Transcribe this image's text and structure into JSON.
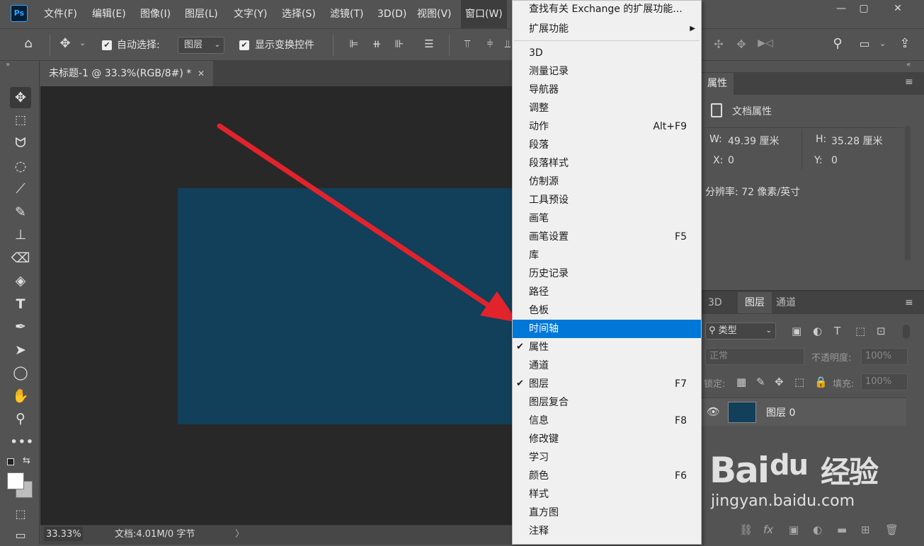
{
  "app": {
    "logo": "Ps"
  },
  "menubar": {
    "items": [
      "文件(F)",
      "编辑(E)",
      "图像(I)",
      "图层(L)",
      "文字(Y)",
      "选择(S)",
      "滤镜(T)",
      "3D(D)",
      "视图(V)",
      "窗口(W)"
    ],
    "window_controls": {
      "minimize": "—",
      "restore": "▢",
      "close": "✕"
    }
  },
  "options_bar": {
    "auto_select_label": "自动选择:",
    "auto_select_value": "图层",
    "show_transform_label": "显示变换控件"
  },
  "document": {
    "tab_title": "未标题-1 @ 33.3%(RGB/8#) *",
    "tab_close": "✕",
    "canvas_color": "#123f5a"
  },
  "statusbar": {
    "zoom": "33.33%",
    "doc_info": "文档:4.01M/0 字节",
    "arrow": "〉"
  },
  "properties_panel": {
    "tab": "属性",
    "doc_props_label": "文档属性",
    "w_label": "W:",
    "w_value": "49.39 厘米",
    "h_label": "H:",
    "h_value": "35.28 厘米",
    "x_label": "X:",
    "x_value": "0",
    "y_label": "Y:",
    "y_value": "0",
    "resolution": "分辨率: 72 像素/英寸"
  },
  "layers_panel": {
    "tabs": [
      "3D",
      "图层",
      "通道"
    ],
    "filter_label": "类型",
    "blend_mode": "正常",
    "opacity_label": "不透明度:",
    "opacity_value": "100%",
    "lock_label": "锁定:",
    "fill_label": "填充:",
    "fill_value": "100%",
    "layer_name": "图层 0",
    "layer_color": "#123f5a"
  },
  "window_menu": {
    "top": [
      {
        "label": "查找有关 Exchange 的扩展功能..."
      },
      {
        "label": "扩展功能",
        "submenu": true
      }
    ],
    "items": [
      {
        "label": "3D",
        "shortcut": ""
      },
      {
        "label": "测量记录",
        "shortcut": ""
      },
      {
        "label": "导航器",
        "shortcut": ""
      },
      {
        "label": "调整",
        "shortcut": ""
      },
      {
        "label": "动作",
        "shortcut": "Alt+F9"
      },
      {
        "label": "段落",
        "shortcut": ""
      },
      {
        "label": "段落样式",
        "shortcut": ""
      },
      {
        "label": "仿制源",
        "shortcut": ""
      },
      {
        "label": "工具预设",
        "shortcut": ""
      },
      {
        "label": "画笔",
        "shortcut": ""
      },
      {
        "label": "画笔设置",
        "shortcut": "F5"
      },
      {
        "label": "库",
        "shortcut": ""
      },
      {
        "label": "历史记录",
        "shortcut": ""
      },
      {
        "label": "路径",
        "shortcut": ""
      },
      {
        "label": "色板",
        "shortcut": ""
      },
      {
        "label": "时间轴",
        "shortcut": "",
        "highlighted": true
      },
      {
        "label": "属性",
        "shortcut": "",
        "checked": true
      },
      {
        "label": "通道",
        "shortcut": ""
      },
      {
        "label": "图层",
        "shortcut": "F7",
        "checked": true
      },
      {
        "label": "图层复合",
        "shortcut": ""
      },
      {
        "label": "信息",
        "shortcut": "F8"
      },
      {
        "label": "修改键",
        "shortcut": ""
      },
      {
        "label": "学习",
        "shortcut": ""
      },
      {
        "label": "颜色",
        "shortcut": "F6"
      },
      {
        "label": "样式",
        "shortcut": ""
      },
      {
        "label": "直方图",
        "shortcut": ""
      },
      {
        "label": "注释",
        "shortcut": ""
      }
    ]
  },
  "watermark": {
    "brand": "Bai",
    "brand2": "du",
    "jingyan": "经验",
    "url": "jingyan.baidu.com"
  },
  "colors": {
    "highlight": "#0078d7",
    "arrow": "#e3232c"
  }
}
